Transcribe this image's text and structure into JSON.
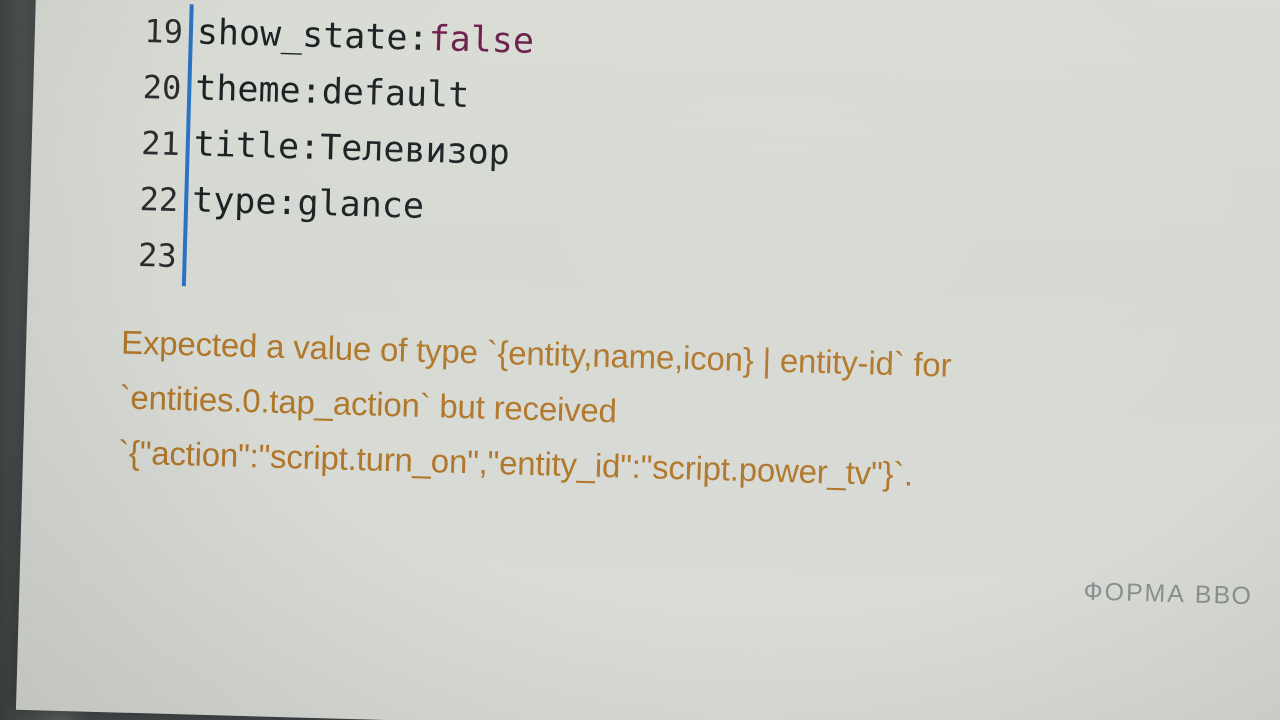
{
  "editor": {
    "lines": [
      {
        "number": "19",
        "key": "show_state",
        "value": "false"
      },
      {
        "number": "20",
        "key": "theme",
        "value": "default"
      },
      {
        "number": "21",
        "key": "title",
        "value": "Телевизор"
      },
      {
        "number": "22",
        "key": "type",
        "value": "glance"
      },
      {
        "number": "23",
        "key": "",
        "value": ""
      }
    ]
  },
  "error": {
    "line1": "Expected a value of type `{entity,name,icon} | entity-id` for",
    "line2": "`entities.0.tap_action` but received",
    "line3": "`{\"action\":\"script.turn_on\",\"entity_id\":\"script.power_tv\"}`."
  },
  "footer": {
    "form_label": "ФОРМА ВВО"
  },
  "colors": {
    "gutter_accent": "#2a72c4",
    "error_text": "#b0772a",
    "boolean_value": "#6b1f4a"
  }
}
